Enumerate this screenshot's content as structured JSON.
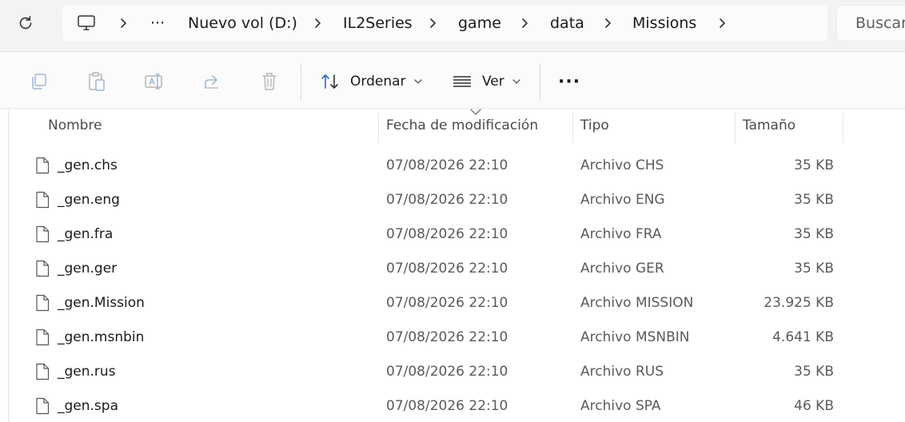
{
  "address": {
    "breadcrumbs": [
      "Nuevo vol (D:)",
      "IL2Series",
      "game",
      "data",
      "Missions"
    ],
    "overflow_label": "···",
    "search_placeholder": "Buscar"
  },
  "toolbar": {
    "sort_label": "Ordenar",
    "view_label": "Ver",
    "more_label": "···"
  },
  "columns": {
    "name": "Nombre",
    "date": "Fecha de modificación",
    "type": "Tipo",
    "size": "Tamaño",
    "sorted_by": "date"
  },
  "files": [
    {
      "name": "_gen.chs",
      "date": "07/08/2026 22:10",
      "type": "Archivo CHS",
      "size": "35 KB"
    },
    {
      "name": "_gen.eng",
      "date": "07/08/2026 22:10",
      "type": "Archivo ENG",
      "size": "35 KB"
    },
    {
      "name": "_gen.fra",
      "date": "07/08/2026 22:10",
      "type": "Archivo FRA",
      "size": "35 KB"
    },
    {
      "name": "_gen.ger",
      "date": "07/08/2026 22:10",
      "type": "Archivo GER",
      "size": "35 KB"
    },
    {
      "name": "_gen.Mission",
      "date": "07/08/2026 22:10",
      "type": "Archivo MISSION",
      "size": "23.925 KB"
    },
    {
      "name": "_gen.msnbin",
      "date": "07/08/2026 22:10",
      "type": "Archivo MSNBIN",
      "size": "4.641 KB"
    },
    {
      "name": "_gen.rus",
      "date": "07/08/2026 22:10",
      "type": "Archivo RUS",
      "size": "35 KB"
    },
    {
      "name": "_gen.spa",
      "date": "07/08/2026 22:10",
      "type": "Archivo SPA",
      "size": "46 KB"
    }
  ],
  "icons": {
    "refresh": "refresh-icon",
    "computer": "computer-icon",
    "copy": "copy-icon",
    "paste": "paste-icon",
    "rename": "rename-icon",
    "share": "share-icon",
    "delete": "delete-icon",
    "sort": "sort-icon",
    "view": "view-icon",
    "file": "file-icon"
  },
  "colors": {
    "address_bg": "#f3f3f3",
    "toolbar_bg": "#fbfbfb",
    "icon_accent": "#2a6ab8",
    "disabled_icon": "#9fb8d6"
  }
}
